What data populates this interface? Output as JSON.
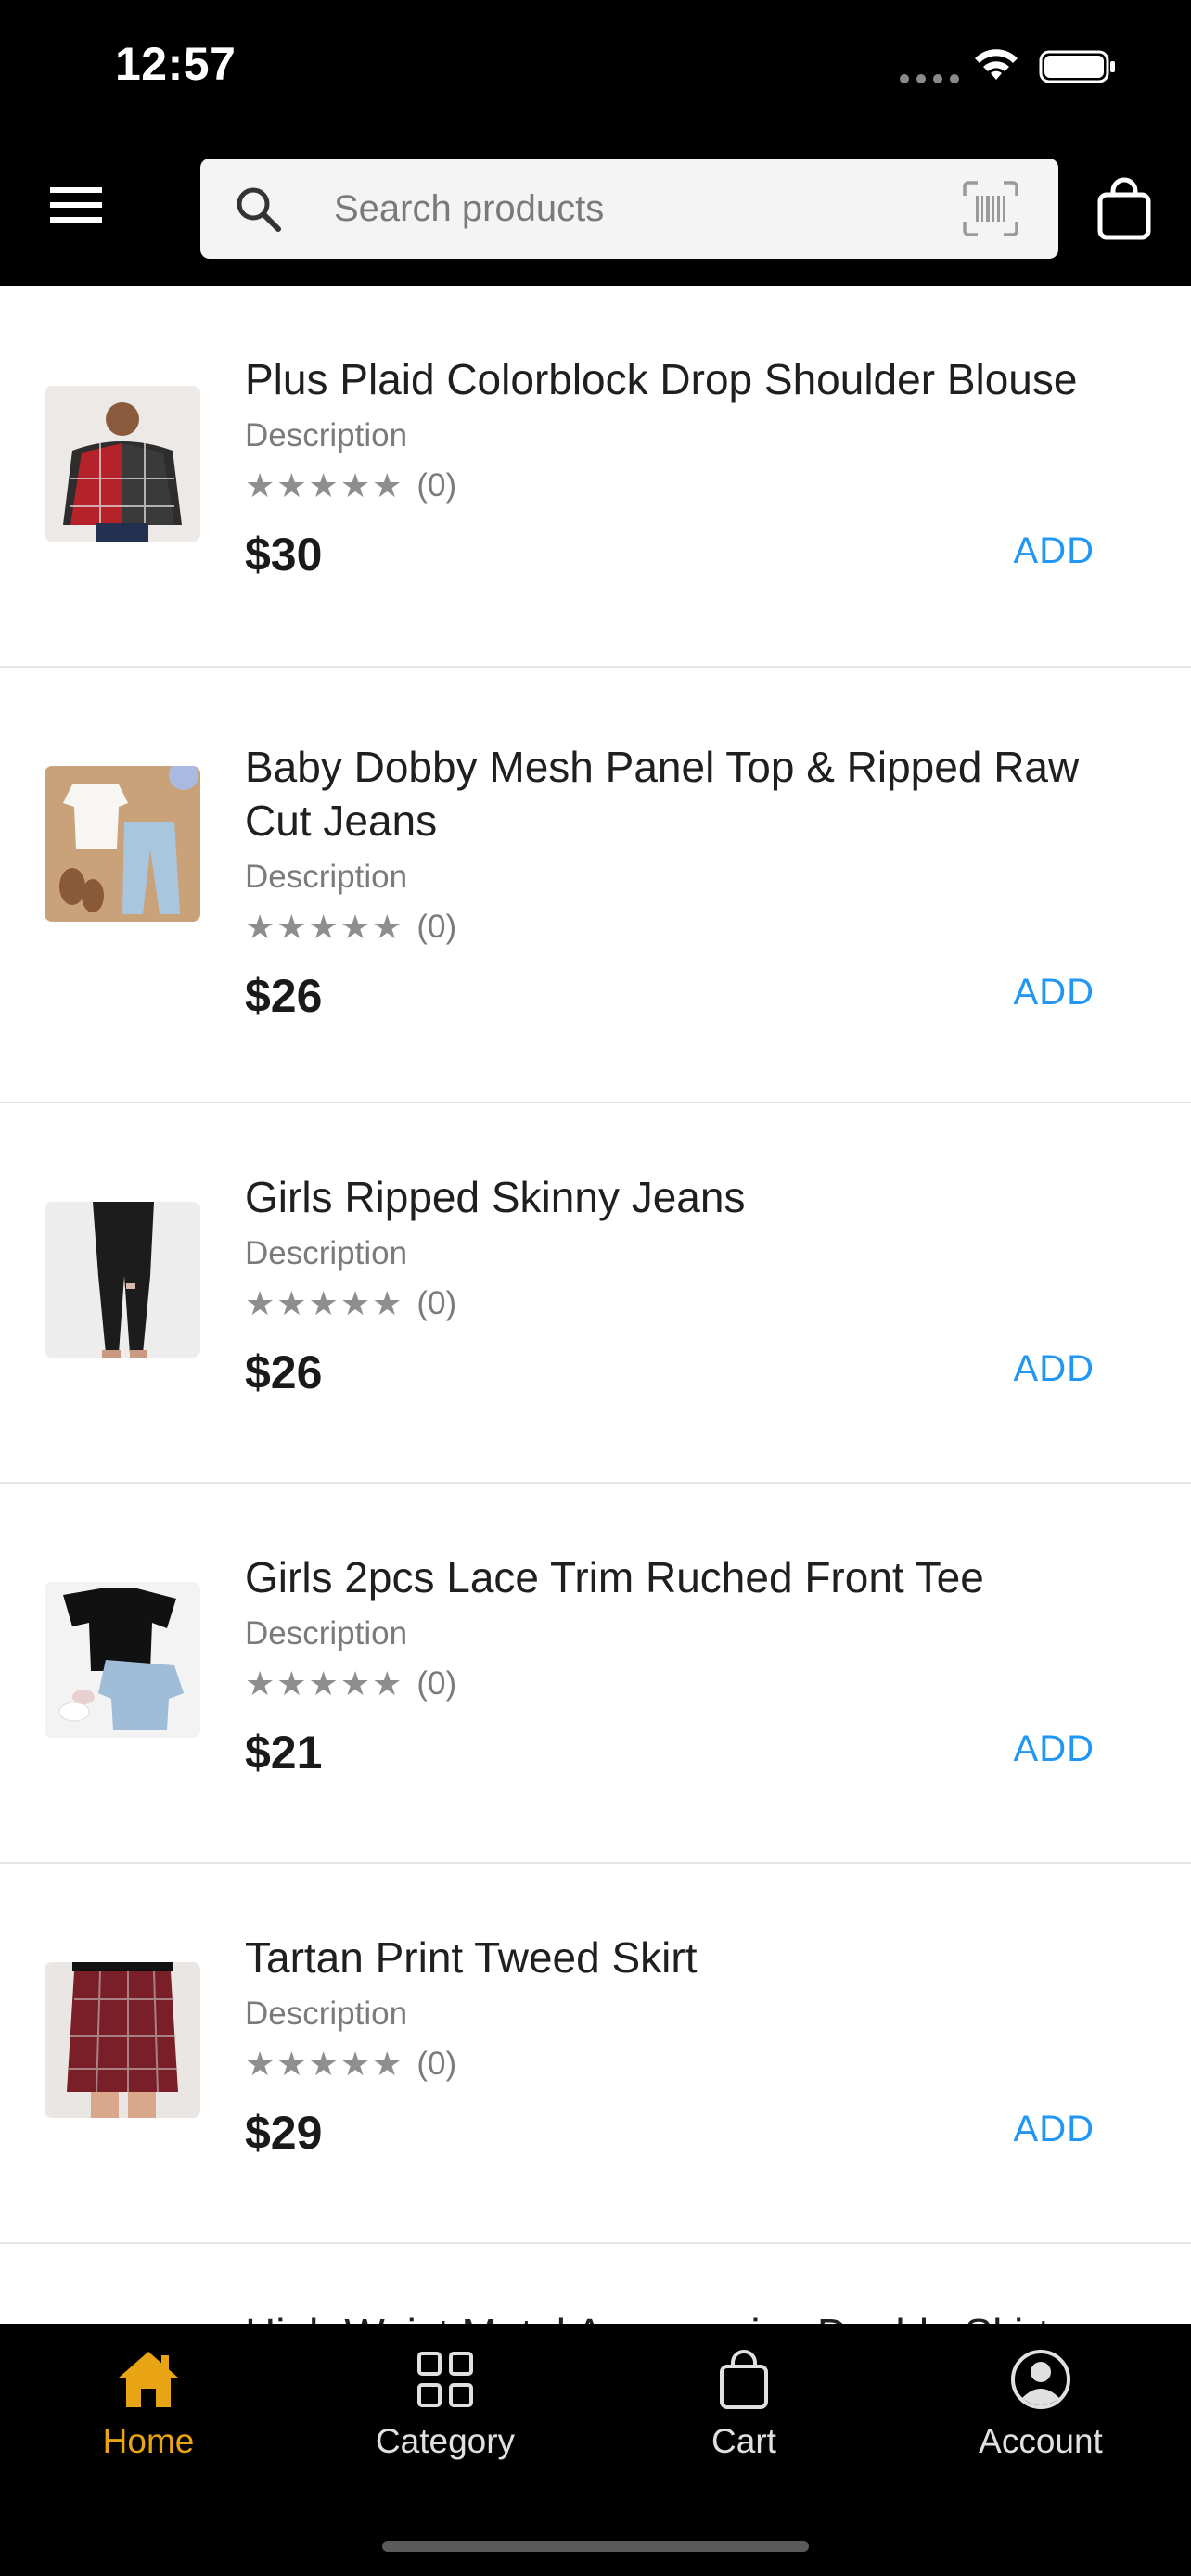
{
  "status_bar": {
    "time": "12:57"
  },
  "header": {
    "search_placeholder": "Search products",
    "icons": [
      "menu-icon",
      "search-icon",
      "barcode-icon",
      "shopping-bag-icon"
    ]
  },
  "products": [
    {
      "name": "Plus Plaid Colorblock Drop Shoulder Blouse",
      "description": "Description",
      "stars": "★★★★★",
      "reviews": "(0)",
      "price": "$30",
      "add_label": "ADD"
    },
    {
      "name": "Baby Dobby Mesh Panel Top & Ripped Raw Cut Jeans",
      "description": "Description",
      "stars": "★★★★★",
      "reviews": "(0)",
      "price": "$26",
      "add_label": "ADD"
    },
    {
      "name": "Girls Ripped Skinny Jeans",
      "description": "Description",
      "stars": "★★★★★",
      "reviews": "(0)",
      "price": "$26",
      "add_label": "ADD"
    },
    {
      "name": "Girls 2pcs Lace Trim Ruched Front Tee",
      "description": "Description",
      "stars": "★★★★★",
      "reviews": "(0)",
      "price": "$21",
      "add_label": "ADD"
    },
    {
      "name": "Tartan Print Tweed Skirt",
      "description": "Description",
      "stars": "★★★★★",
      "reviews": "(0)",
      "price": "$29",
      "add_label": "ADD"
    }
  ],
  "partial_item": {
    "name": "High Waist Metal Accessories Double Skirt"
  },
  "tabbar": {
    "tabs": [
      {
        "label": "Home",
        "icon": "home-icon",
        "active": true
      },
      {
        "label": "Category",
        "icon": "grid-icon",
        "active": false
      },
      {
        "label": "Cart",
        "icon": "bag-icon",
        "active": false
      },
      {
        "label": "Account",
        "icon": "account-icon",
        "active": false
      }
    ],
    "active_color": "#e8a413",
    "inactive_color": "#e0e0e0"
  },
  "colors": {
    "add_button": "#2196f3",
    "header_bg": "#000000"
  }
}
